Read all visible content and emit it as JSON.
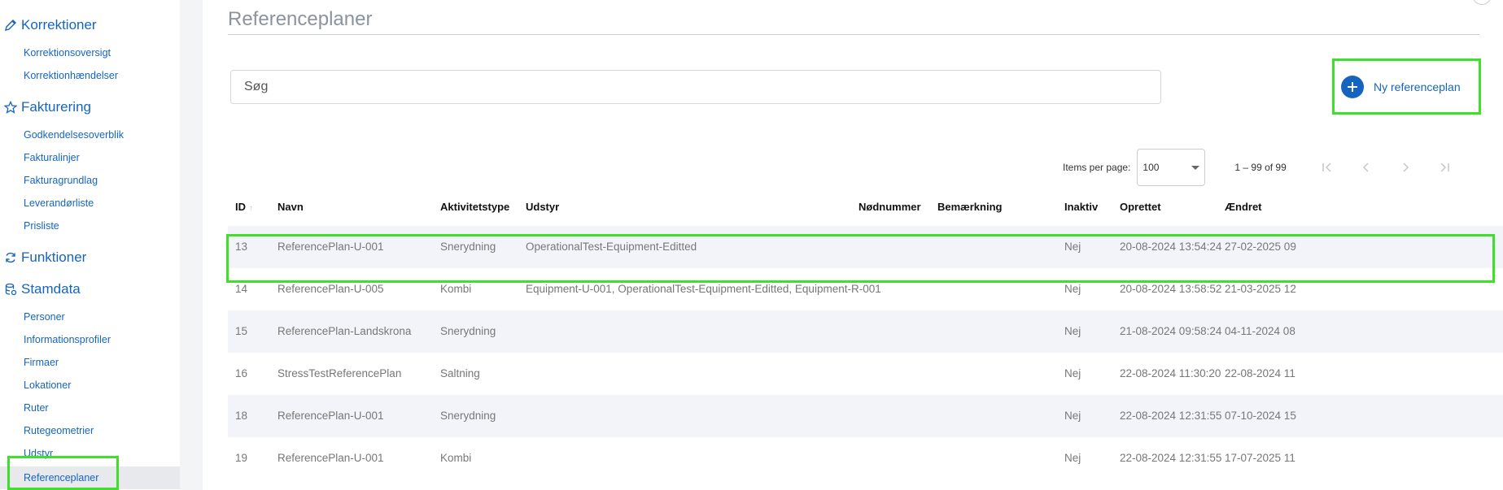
{
  "sidebar": {
    "sections": [
      {
        "label": "Korrektioner",
        "icon": "pencil-icon"
      },
      {
        "label": "Fakturering",
        "icon": "star-icon"
      },
      {
        "label": "Funktioner",
        "icon": "refresh-icon"
      },
      {
        "label": "Stamdata",
        "icon": "database-icon"
      }
    ],
    "korrektioner_items": [
      "Korrektionsoversigt",
      "Korrektionhændelser"
    ],
    "fakturering_items": [
      "Godkendelsesoverblik",
      "Fakturalinjer",
      "Fakturagrundlag",
      "Leverandørliste",
      "Prisliste"
    ],
    "stamdata_items": [
      "Personer",
      "Informationsprofiler",
      "Firmaer",
      "Lokationer",
      "Ruter",
      "Rutegeometrier",
      "Udstyr",
      "Referenceplaner"
    ],
    "active_item": "Referenceplaner"
  },
  "page": {
    "title": "Referenceplaner",
    "search_placeholder": "Søg",
    "new_button_label": "Ny referenceplan"
  },
  "paginator": {
    "items_per_page_label": "Items per page:",
    "items_per_page_value": "100",
    "range_label": "1 – 99 of 99"
  },
  "table": {
    "headers": {
      "id": "ID",
      "navn": "Navn",
      "aktivitetstype": "Aktivitetstype",
      "udstyr": "Udstyr",
      "nodnummer": "Nødnummer",
      "bemaerkning": "Bemærkning",
      "inaktiv": "Inaktiv",
      "oprettet": "Oprettet",
      "aendret": "Ændret"
    },
    "rows": [
      {
        "id": "13",
        "navn": "ReferencePlan-U-001",
        "aktivitetstype": "Snerydning",
        "udstyr": "OperationalTest-Equipment-Editted",
        "nodnummer": "",
        "bemaerkning": "",
        "inaktiv": "Nej",
        "oprettet": "20-08-2024 13:54:24",
        "aendret": "27-02-2025 09"
      },
      {
        "id": "14",
        "navn": "ReferencePlan-U-005",
        "aktivitetstype": "Kombi",
        "udstyr": "Equipment-U-001, OperationalTest-Equipment-Editted, Equipment-R-001",
        "nodnummer": "",
        "bemaerkning": "",
        "inaktiv": "Nej",
        "oprettet": "20-08-2024 13:58:52",
        "aendret": "21-03-2025 12"
      },
      {
        "id": "15",
        "navn": "ReferencePlan-Landskrona",
        "aktivitetstype": "Snerydning",
        "udstyr": "",
        "nodnummer": "",
        "bemaerkning": "",
        "inaktiv": "Nej",
        "oprettet": "21-08-2024 09:58:24",
        "aendret": "04-11-2024 08"
      },
      {
        "id": "16",
        "navn": "StressTestReferencePlan",
        "aktivitetstype": "Saltning",
        "udstyr": "",
        "nodnummer": "",
        "bemaerkning": "",
        "inaktiv": "Nej",
        "oprettet": "22-08-2024 11:30:20",
        "aendret": "22-08-2024 11"
      },
      {
        "id": "18",
        "navn": "ReferencePlan-U-001",
        "aktivitetstype": "Snerydning",
        "udstyr": "",
        "nodnummer": "",
        "bemaerkning": "",
        "inaktiv": "Nej",
        "oprettet": "22-08-2024 12:31:55",
        "aendret": "07-10-2024 15"
      },
      {
        "id": "19",
        "navn": "ReferencePlan-U-001",
        "aktivitetstype": "Kombi",
        "udstyr": "",
        "nodnummer": "",
        "bemaerkning": "",
        "inaktiv": "Nej",
        "oprettet": "22-08-2024 12:31:55",
        "aendret": "17-07-2025 11"
      }
    ]
  },
  "colors": {
    "accent": "#1565c0",
    "highlight": "#3ee02a",
    "row_shade": "#f3f4fa"
  }
}
